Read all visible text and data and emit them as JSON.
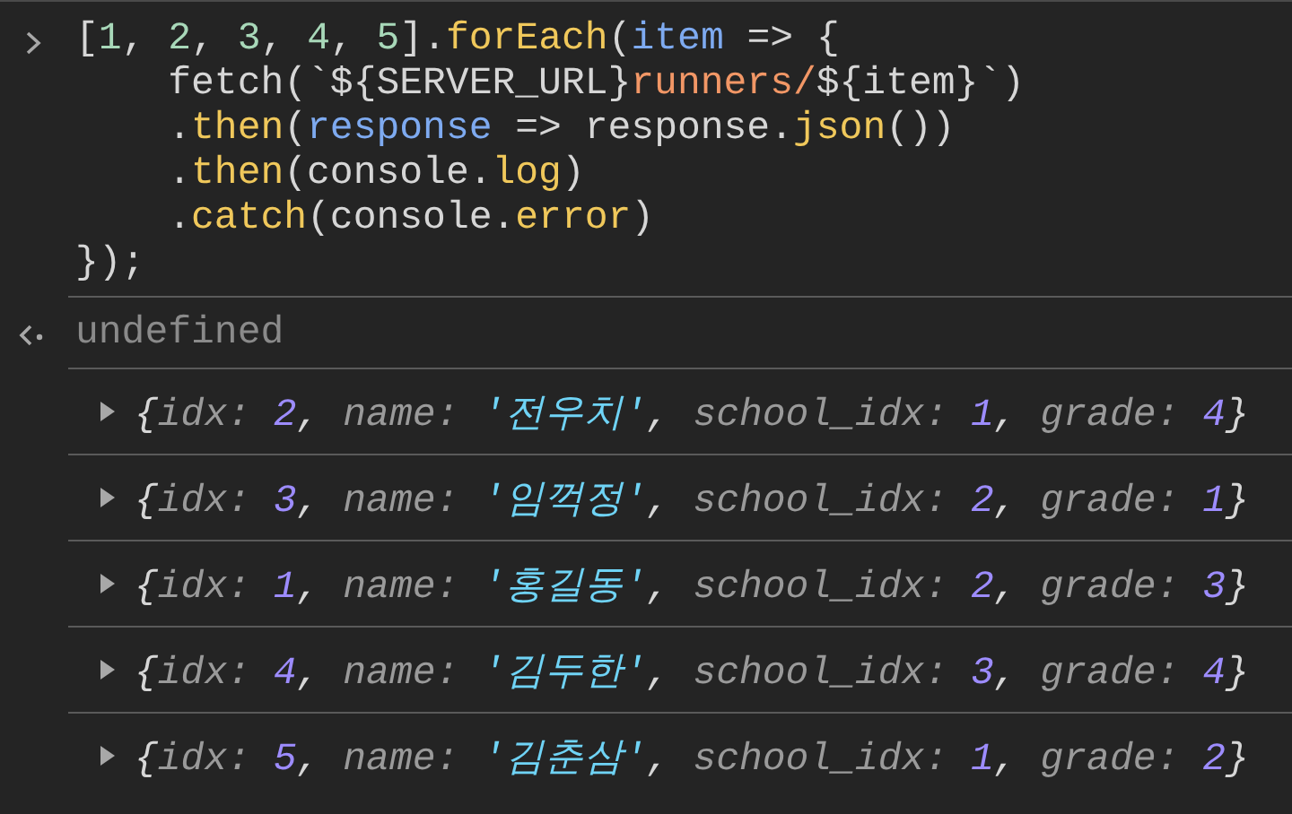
{
  "console": {
    "input": {
      "lines": [
        [
          {
            "kind": "plain",
            "text": "["
          },
          {
            "kind": "number",
            "text": "1"
          },
          {
            "kind": "plain",
            "text": ", "
          },
          {
            "kind": "number",
            "text": "2"
          },
          {
            "kind": "plain",
            "text": ", "
          },
          {
            "kind": "number",
            "text": "3"
          },
          {
            "kind": "plain",
            "text": ", "
          },
          {
            "kind": "number",
            "text": "4"
          },
          {
            "kind": "plain",
            "text": ", "
          },
          {
            "kind": "number",
            "text": "5"
          },
          {
            "kind": "plain",
            "text": "]."
          },
          {
            "kind": "method",
            "text": "forEach"
          },
          {
            "kind": "plain",
            "text": "("
          },
          {
            "kind": "param",
            "text": "item"
          },
          {
            "kind": "plain",
            "text": " => {"
          }
        ],
        [
          {
            "kind": "plain",
            "text": "    fetch(`${SERVER_URL}"
          },
          {
            "kind": "template",
            "text": "runners/"
          },
          {
            "kind": "plain",
            "text": "${item}`)"
          }
        ],
        [
          {
            "kind": "plain",
            "text": "    ."
          },
          {
            "kind": "method",
            "text": "then"
          },
          {
            "kind": "plain",
            "text": "("
          },
          {
            "kind": "param",
            "text": "response"
          },
          {
            "kind": "plain",
            "text": " => response."
          },
          {
            "kind": "method",
            "text": "json"
          },
          {
            "kind": "plain",
            "text": "())"
          }
        ],
        [
          {
            "kind": "plain",
            "text": "    ."
          },
          {
            "kind": "method",
            "text": "then"
          },
          {
            "kind": "plain",
            "text": "(console."
          },
          {
            "kind": "method",
            "text": "log"
          },
          {
            "kind": "plain",
            "text": ")"
          }
        ],
        [
          {
            "kind": "plain",
            "text": "    ."
          },
          {
            "kind": "method",
            "text": "catch"
          },
          {
            "kind": "plain",
            "text": "(console."
          },
          {
            "kind": "method",
            "text": "error"
          },
          {
            "kind": "plain",
            "text": ")"
          }
        ],
        [
          {
            "kind": "plain",
            "text": "});"
          }
        ]
      ]
    },
    "result": {
      "text": "undefined"
    },
    "logs": [
      {
        "expanded": false,
        "tokens": [
          {
            "kind": "plain",
            "text": "{"
          },
          {
            "kind": "key",
            "text": "idx: "
          },
          {
            "kind": "value",
            "text": "2"
          },
          {
            "kind": "plain",
            "text": ", "
          },
          {
            "kind": "key",
            "text": "name: "
          },
          {
            "kind": "string",
            "text": "'전우치'"
          },
          {
            "kind": "plain",
            "text": ", "
          },
          {
            "kind": "key",
            "text": "school_idx: "
          },
          {
            "kind": "value",
            "text": "1"
          },
          {
            "kind": "plain",
            "text": ", "
          },
          {
            "kind": "key",
            "text": "grade: "
          },
          {
            "kind": "value",
            "text": "4"
          },
          {
            "kind": "plain",
            "text": "}"
          }
        ]
      },
      {
        "expanded": false,
        "tokens": [
          {
            "kind": "plain",
            "text": "{"
          },
          {
            "kind": "key",
            "text": "idx: "
          },
          {
            "kind": "value",
            "text": "3"
          },
          {
            "kind": "plain",
            "text": ", "
          },
          {
            "kind": "key",
            "text": "name: "
          },
          {
            "kind": "string",
            "text": "'임꺽정'"
          },
          {
            "kind": "plain",
            "text": ", "
          },
          {
            "kind": "key",
            "text": "school_idx: "
          },
          {
            "kind": "value",
            "text": "2"
          },
          {
            "kind": "plain",
            "text": ", "
          },
          {
            "kind": "key",
            "text": "grade: "
          },
          {
            "kind": "value",
            "text": "1"
          },
          {
            "kind": "plain",
            "text": "}"
          }
        ]
      },
      {
        "expanded": false,
        "tokens": [
          {
            "kind": "plain",
            "text": "{"
          },
          {
            "kind": "key",
            "text": "idx: "
          },
          {
            "kind": "value",
            "text": "1"
          },
          {
            "kind": "plain",
            "text": ", "
          },
          {
            "kind": "key",
            "text": "name: "
          },
          {
            "kind": "string",
            "text": "'홍길동'"
          },
          {
            "kind": "plain",
            "text": ", "
          },
          {
            "kind": "key",
            "text": "school_idx: "
          },
          {
            "kind": "value",
            "text": "2"
          },
          {
            "kind": "plain",
            "text": ", "
          },
          {
            "kind": "key",
            "text": "grade: "
          },
          {
            "kind": "value",
            "text": "3"
          },
          {
            "kind": "plain",
            "text": "}"
          }
        ]
      },
      {
        "expanded": false,
        "tokens": [
          {
            "kind": "plain",
            "text": "{"
          },
          {
            "kind": "key",
            "text": "idx: "
          },
          {
            "kind": "value",
            "text": "4"
          },
          {
            "kind": "plain",
            "text": ", "
          },
          {
            "kind": "key",
            "text": "name: "
          },
          {
            "kind": "string",
            "text": "'김두한'"
          },
          {
            "kind": "plain",
            "text": ", "
          },
          {
            "kind": "key",
            "text": "school_idx: "
          },
          {
            "kind": "value",
            "text": "3"
          },
          {
            "kind": "plain",
            "text": ", "
          },
          {
            "kind": "key",
            "text": "grade: "
          },
          {
            "kind": "value",
            "text": "4"
          },
          {
            "kind": "plain",
            "text": "}"
          }
        ]
      },
      {
        "expanded": false,
        "tokens": [
          {
            "kind": "plain",
            "text": "{"
          },
          {
            "kind": "key",
            "text": "idx: "
          },
          {
            "kind": "value",
            "text": "5"
          },
          {
            "kind": "plain",
            "text": ", "
          },
          {
            "kind": "key",
            "text": "name: "
          },
          {
            "kind": "string",
            "text": "'김춘삼'"
          },
          {
            "kind": "plain",
            "text": ", "
          },
          {
            "kind": "key",
            "text": "school_idx: "
          },
          {
            "kind": "value",
            "text": "1"
          },
          {
            "kind": "plain",
            "text": ", "
          },
          {
            "kind": "key",
            "text": "grade: "
          },
          {
            "kind": "value",
            "text": "2"
          },
          {
            "kind": "plain",
            "text": "}"
          }
        ]
      }
    ]
  }
}
